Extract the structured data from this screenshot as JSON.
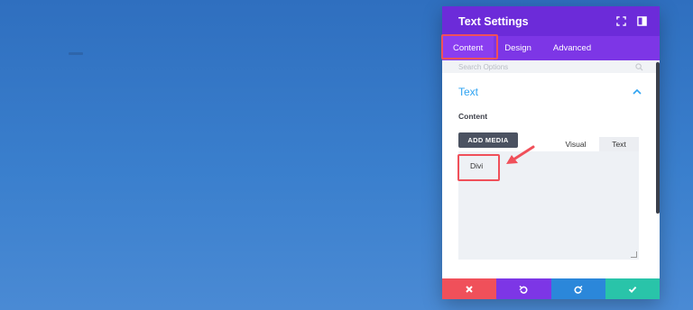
{
  "panel": {
    "title": "Text Settings",
    "header_icons": [
      "fullscreen-icon",
      "split-view-icon"
    ],
    "tabs": [
      {
        "label": "Content",
        "active": true
      },
      {
        "label": "Design",
        "active": false
      },
      {
        "label": "Advanced",
        "active": false
      }
    ],
    "search": {
      "placeholder": "Search Options",
      "icon": "search-icon"
    },
    "section": {
      "title": "Text",
      "icon": "chevron-up-icon"
    },
    "field": {
      "label": "Content",
      "add_media": "ADD MEDIA",
      "editor_tabs": [
        "Visual",
        "Text"
      ],
      "value": "Divi"
    },
    "footer": [
      {
        "icon": "close-icon",
        "color": "#f0505a"
      },
      {
        "icon": "undo-icon",
        "color": "#7d36e6"
      },
      {
        "icon": "redo-icon",
        "color": "#2b87da"
      },
      {
        "icon": "check-icon",
        "color": "#29c4a9"
      }
    ]
  },
  "colors": {
    "background": "#3a7fcd",
    "header": "#6c2bd9",
    "tabs": "#7d36e6",
    "accent": "#2ea3f2",
    "highlight": "#f0505a"
  }
}
